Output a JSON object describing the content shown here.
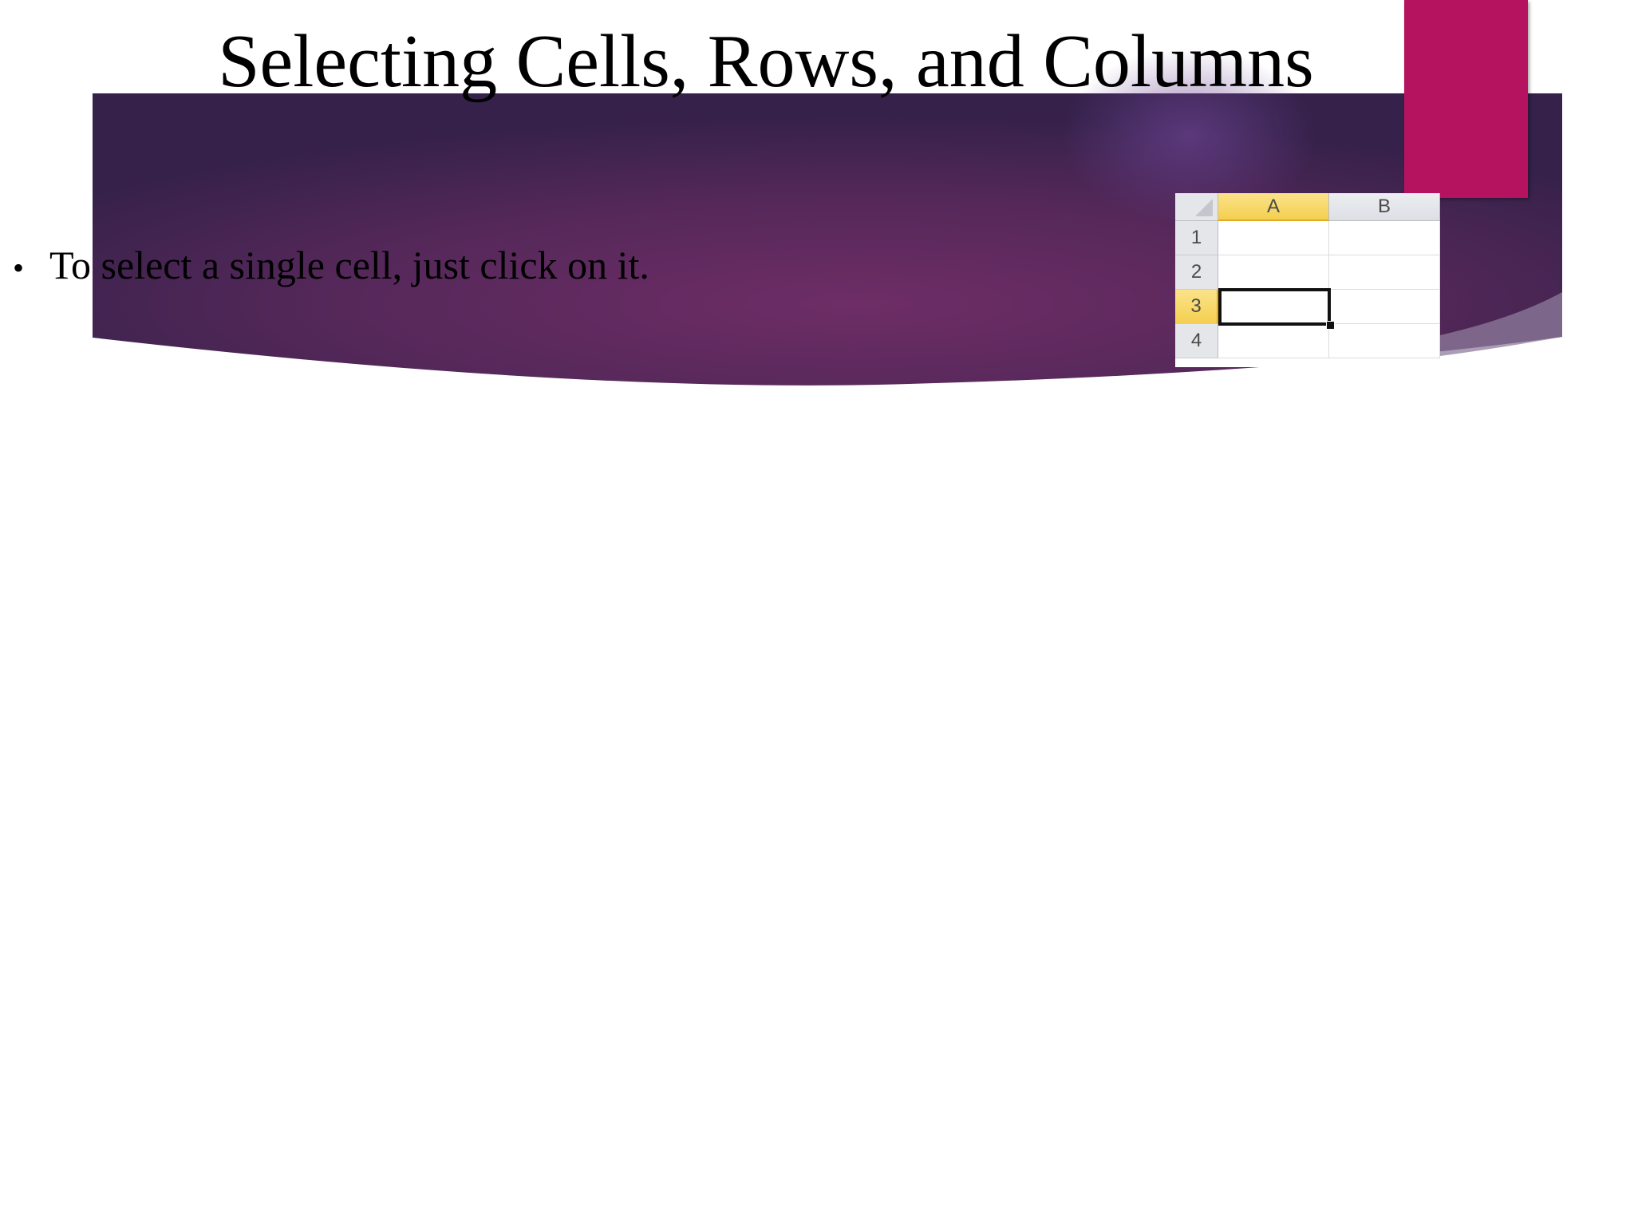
{
  "slide": {
    "title": "Selecting Cells, Rows, and Columns",
    "bullets": [
      {
        "text": "To select a single cell, just click on it."
      }
    ]
  },
  "spreadsheet": {
    "columns": [
      "A",
      "B"
    ],
    "rows": [
      "1",
      "2",
      "3",
      "4"
    ],
    "active_column": "A",
    "active_row": "3"
  },
  "colors": {
    "accent": "#b5135f",
    "banner_dark": "#3a2350",
    "banner_mid": "#6a2d63",
    "excel_highlight": "#f4cf4f"
  }
}
